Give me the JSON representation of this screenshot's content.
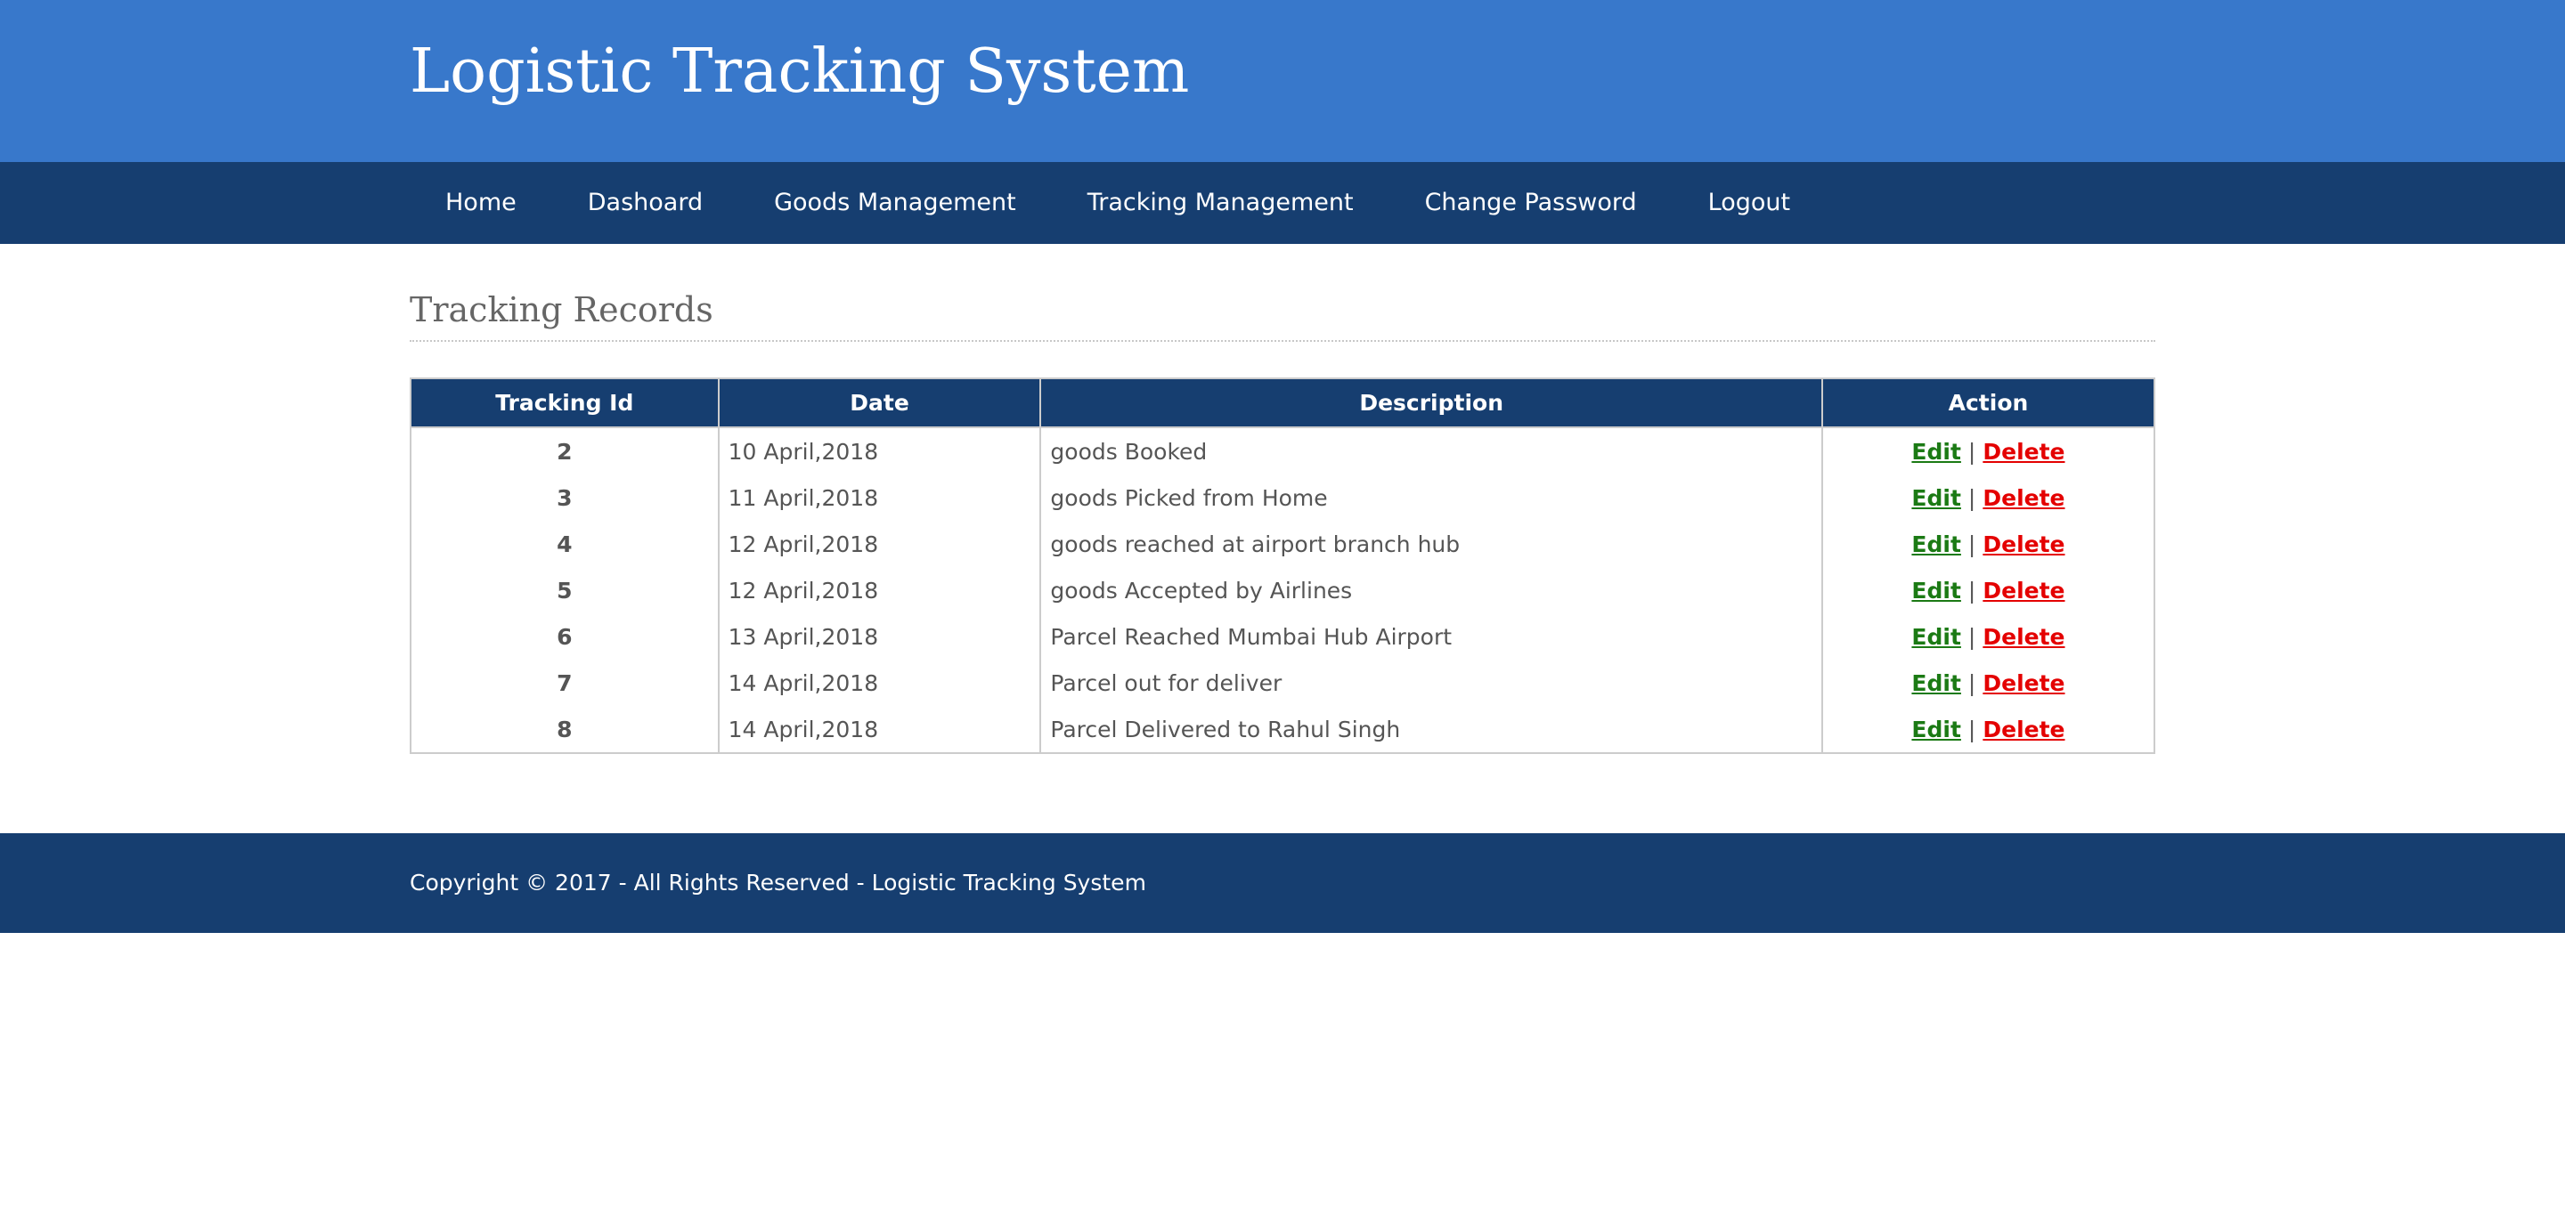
{
  "header": {
    "title": "Logistic Tracking System"
  },
  "nav": {
    "items": [
      {
        "label": "Home"
      },
      {
        "label": "Dashoard"
      },
      {
        "label": "Goods Management"
      },
      {
        "label": "Tracking Management"
      },
      {
        "label": "Change Password"
      },
      {
        "label": "Logout"
      }
    ]
  },
  "main": {
    "heading": "Tracking Records",
    "table": {
      "columns": [
        "Tracking Id",
        "Date",
        "Description",
        "Action"
      ],
      "edit_label": "Edit",
      "separator": "|",
      "delete_label": "Delete",
      "rows": [
        {
          "id": "2",
          "date": "10 April,2018",
          "description": "goods Booked"
        },
        {
          "id": "3",
          "date": "11 April,2018",
          "description": "goods Picked from Home"
        },
        {
          "id": "4",
          "date": "12 April,2018",
          "description": "goods reached at airport branch hub"
        },
        {
          "id": "5",
          "date": "12 April,2018",
          "description": "goods Accepted by Airlines"
        },
        {
          "id": "6",
          "date": "13 April,2018",
          "description": "Parcel Reached Mumbai Hub Airport"
        },
        {
          "id": "7",
          "date": "14 April,2018",
          "description": "Parcel out for deliver"
        },
        {
          "id": "8",
          "date": "14 April,2018",
          "description": "Parcel Delivered to Rahul Singh"
        }
      ]
    }
  },
  "footer": {
    "copyright": "Copyright © 2017 - All Rights Reserved - Logistic Tracking System"
  },
  "colors": {
    "header_bg": "#3878cb",
    "nav_bg": "#163e70",
    "edit_link": "#1b7a14",
    "delete_link": "#e40000"
  }
}
